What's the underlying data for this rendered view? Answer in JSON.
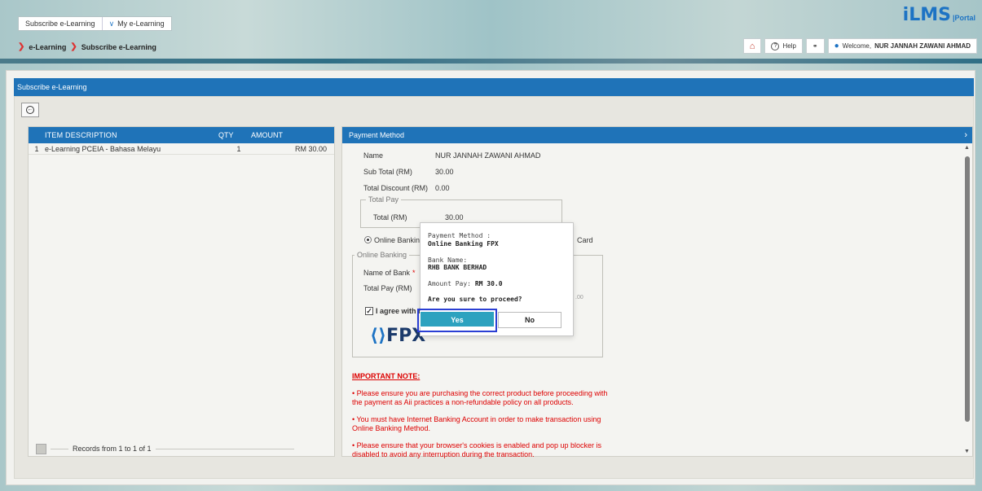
{
  "header": {
    "tabs": [
      {
        "label": "Subscribe e-Learning"
      },
      {
        "label": "My e-Learning"
      }
    ],
    "breadcrumb": [
      "e-Learning",
      "Subscribe e-Learning"
    ],
    "logo_main": "iLMS",
    "logo_sub": "|Portal",
    "tools": {
      "help": "Help",
      "welcome_prefix": "Welcome,",
      "user_name": "NUR JANNAH ZAWANI AHMAD"
    }
  },
  "page": {
    "title": "Subscribe e-Learning"
  },
  "items_table": {
    "headers": {
      "description": "ITEM DESCRIPTION",
      "qty": "QTY",
      "amount": "AMOUNT"
    },
    "rows": [
      {
        "no": "1",
        "description": "e-Learning PCEIA - Bahasa Melayu",
        "qty": "1",
        "amount": "RM 30.00"
      }
    ],
    "records_text": "Records from 1 to 1 of 1"
  },
  "payment": {
    "title": "Payment Method",
    "name_label": "Name",
    "name_value": "NUR JANNAH ZAWANI AHMAD",
    "subtotal_label": "Sub Total (RM)",
    "subtotal_value": "30.00",
    "discount_label": "Total Discount (RM)",
    "discount_value": "0.00",
    "total_pay_legend": "Total Pay",
    "total_label": "Total (RM)",
    "total_value": "30.00",
    "option_online": "Online Banking",
    "option_card_tail": "Card",
    "online_legend": "Online Banking",
    "bank_label": "Name of Bank",
    "bank_req": "*",
    "total_pay_label": "Total Pay (RM)",
    "total_pay_partial": ".00",
    "agree_text": "I agree with the",
    "fpx_logo": "FPX"
  },
  "notes": {
    "title": "IMPORTANT NOTE:",
    "items": [
      "•  Please ensure you are purchasing the correct product before proceeding with the payment as Aii practices a non-refundable policy on all products.",
      "•  You must have Internet Banking Account in order to make transaction using Online Banking Method.",
      "•  Please ensure that your browser's cookies is enabled and pop up blocker is disabled to avoid any interruption during the transaction."
    ]
  },
  "dialog": {
    "method_label": "Payment Method :",
    "method_value": "Online Banking FPX",
    "bank_label": "Bank Name:",
    "bank_value": "RHB BANK BERHAD",
    "amount_label": "Amount Pay:",
    "amount_value": "RM 30.0",
    "question": "Are you sure to proceed?",
    "yes": "Yes",
    "no": "No"
  },
  "colors": {
    "primary": "#1f73b8",
    "dialog_yes": "#2da2bf",
    "highlight_outline": "#2b3fd4",
    "note_red": "#d00"
  }
}
